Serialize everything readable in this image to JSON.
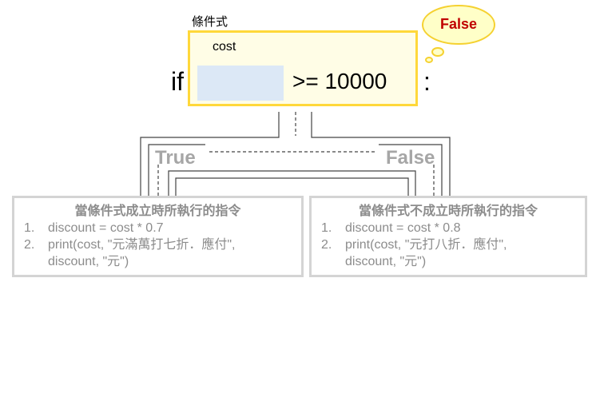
{
  "condition": {
    "label": "條件式",
    "keyword": "if",
    "variable": "cost",
    "operator_expression": ">= 10000",
    "colon": ":",
    "result": "False"
  },
  "branches": {
    "true_label": "True",
    "false_label": "False"
  },
  "true_panel": {
    "title": "當條件式成立時所執行的指令",
    "steps": [
      {
        "num": "1.",
        "lines": [
          "discount = cost * 0.7"
        ]
      },
      {
        "num": "2.",
        "lines": [
          "print(cost, \"元滿萬打七折．應付\",",
          "discount, \"元\")"
        ]
      }
    ]
  },
  "false_panel": {
    "title": "當條件式不成立時所執行的指令",
    "steps": [
      {
        "num": "1.",
        "lines": [
          "discount = cost * 0.8"
        ]
      },
      {
        "num": "2.",
        "lines": [
          "print(cost, \"元打八折．應付\",",
          "discount, \"元\")"
        ]
      }
    ]
  },
  "colors": {
    "condition_border": "#ffd83a",
    "condition_fill": "#fffde6",
    "slot_fill": "#dce8f6",
    "result_text": "#c00000",
    "cloud_border": "#f5d130",
    "cloud_fill": "#ffffc8",
    "muted_text": "#a6a6a6",
    "panel_border": "#d4d4d4"
  }
}
